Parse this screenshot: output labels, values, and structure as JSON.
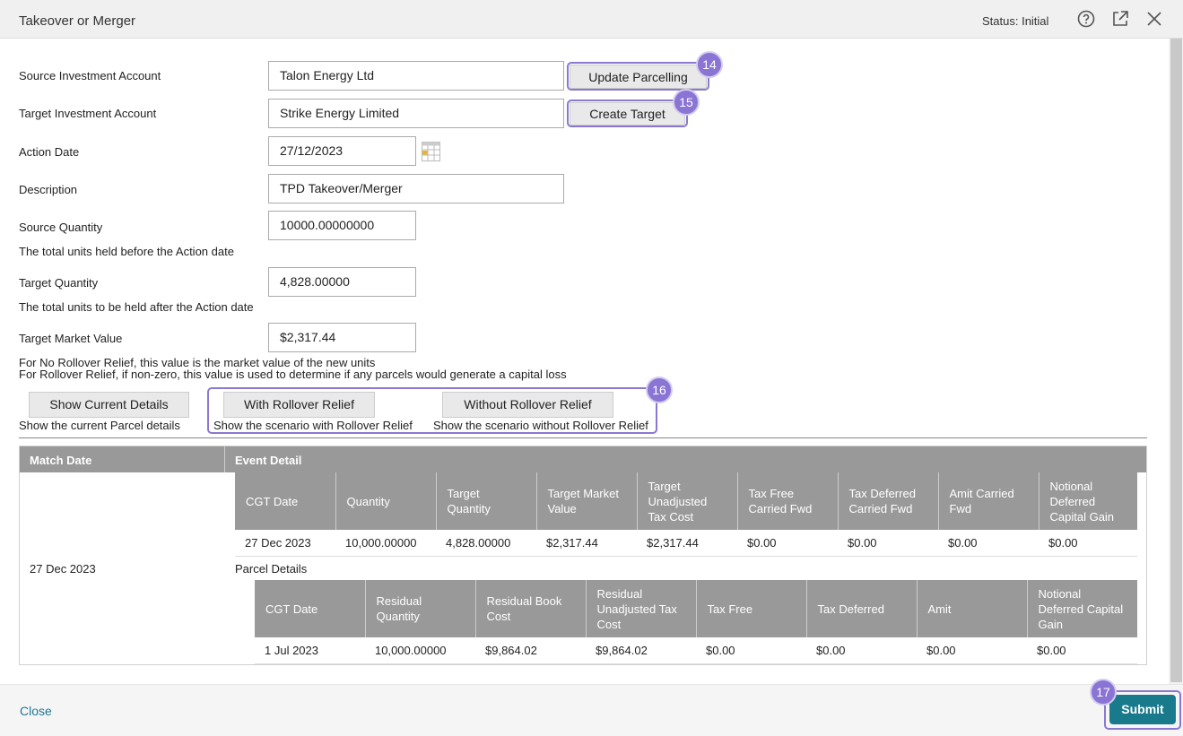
{
  "header": {
    "title": "Takeover or Merger",
    "status": "Status: Initial",
    "help_icon": "help-circle-icon",
    "popout_icon": "external-link-icon",
    "close_icon": "close-icon"
  },
  "form": {
    "source_account": {
      "label": "Source Investment Account",
      "value": "Talon Energy Ltd"
    },
    "target_account": {
      "label": "Target Investment Account",
      "value": "Strike Energy Limited"
    },
    "action_date": {
      "label": "Action Date",
      "value": "27/12/2023"
    },
    "description": {
      "label": "Description",
      "value": "TPD Takeover/Merger"
    },
    "source_quantity": {
      "label": "Source Quantity",
      "value": "10000.00000000",
      "hint": "The total units held before the Action date"
    },
    "target_quantity": {
      "label": "Target Quantity",
      "value": "4,828.00000",
      "hint": "The total units to be held after the Action date"
    },
    "target_market_value": {
      "label": "Target Market Value",
      "value": "$2,317.44",
      "hint1": "For No Rollover Relief, this value is the market value of the new units",
      "hint2": "For Rollover Relief, if non-zero, this value is used to determine if any parcels would generate a capital loss"
    }
  },
  "buttons": {
    "update_parcelling": "Update Parcelling",
    "create_target": "Create Target",
    "show_current": "Show Current Details",
    "show_current_hint": "Show the current Parcel details",
    "with_rollover": "With Rollover Relief",
    "with_rollover_hint": "Show the scenario with Rollover Relief",
    "without_rollover": "Without Rollover Relief",
    "without_rollover_hint": "Show the scenario without Rollover Relief"
  },
  "badges": {
    "b14": "14",
    "b15": "15",
    "b16": "16",
    "b17": "17"
  },
  "results": {
    "col_match_date": "Match Date",
    "col_event_detail": "Event Detail",
    "match_date": "27 Dec 2023",
    "event_table": {
      "headers": [
        "CGT Date",
        "Quantity",
        "Target Quantity",
        "Target Market Value",
        "Target Unadjusted Tax Cost",
        "Tax Free Carried Fwd",
        "Tax Deferred Carried Fwd",
        "Amit Carried Fwd",
        "Notional Deferred Capital Gain"
      ],
      "row": [
        "27 Dec 2023",
        "10,000.00000",
        "4,828.00000",
        "$2,317.44",
        "$2,317.44",
        "$0.00",
        "$0.00",
        "$0.00",
        "$0.00"
      ]
    },
    "parcel_label": "Parcel Details",
    "parcel_table": {
      "headers": [
        "CGT Date",
        "Residual Quantity",
        "Residual Book Cost",
        "Residual Unadjusted Tax Cost",
        "Tax Free",
        "Tax Deferred",
        "Amit",
        "Notional Deferred Capital Gain"
      ],
      "row": [
        "1 Jul 2023",
        "10,000.00000",
        "$9,864.02",
        "$9,864.02",
        "$0.00",
        "$0.00",
        "$0.00",
        "$0.00"
      ]
    }
  },
  "footer": {
    "close": "Close",
    "submit": "Submit"
  },
  "colors": {
    "accent": "#197a8c",
    "highlight": "#8a78d0",
    "table_header": "#999999"
  }
}
